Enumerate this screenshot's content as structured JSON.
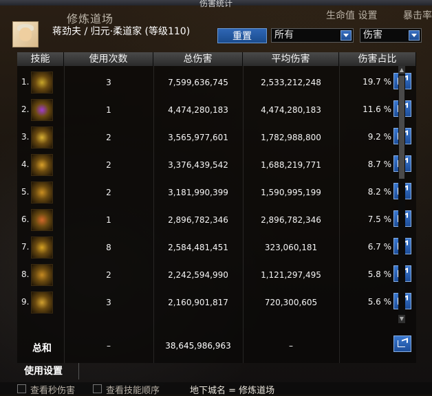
{
  "window": {
    "title": "伤害统计"
  },
  "header": {
    "scene": "修炼道场",
    "character": "蒋劲夫 / 归元·柔道家 (等级110)",
    "reset_label": "重置",
    "filter_selected": "所有",
    "metric_selected": "伤害",
    "side_text_1": "生命值 设置",
    "side_text_2": "暴击率"
  },
  "columns": {
    "skill": "技能",
    "uses": "使用次数",
    "total": "总伤害",
    "avg": "平均伤害",
    "share": "伤害占比"
  },
  "rows": [
    {
      "rank": "1.",
      "uses": "3",
      "total": "7,599,636,745",
      "avg": "2,533,212,248",
      "pct": "19.7 %",
      "icon": "skill-icon-1",
      "color": "#c7a52a"
    },
    {
      "rank": "2.",
      "uses": "1",
      "total": "4,474,280,183",
      "avg": "4,474,280,183",
      "pct": "11.6 %",
      "icon": "skill-icon-2",
      "color": "#a13cd0"
    },
    {
      "rank": "3.",
      "uses": "2",
      "total": "3,565,977,601",
      "avg": "1,782,988,800",
      "pct": "9.2 %",
      "icon": "skill-icon-3",
      "color": "#d8b034"
    },
    {
      "rank": "4.",
      "uses": "2",
      "total": "3,376,439,542",
      "avg": "1,688,219,771",
      "pct": "8.7 %",
      "icon": "skill-icon-4",
      "color": "#d9a02a"
    },
    {
      "rank": "5.",
      "uses": "2",
      "total": "3,181,990,399",
      "avg": "1,590,995,199",
      "pct": "8.2 %",
      "icon": "skill-icon-5",
      "color": "#c98e22"
    },
    {
      "rank": "6.",
      "uses": "1",
      "total": "2,896,782,346",
      "avg": "2,896,782,346",
      "pct": "7.5 %",
      "icon": "skill-icon-6",
      "color": "#d2672a"
    },
    {
      "rank": "7.",
      "uses": "8",
      "total": "2,584,481,451",
      "avg": "323,060,181",
      "pct": "6.7 %",
      "icon": "skill-icon-7",
      "color": "#d6a223"
    },
    {
      "rank": "8.",
      "uses": "2",
      "total": "2,242,594,990",
      "avg": "1,121,297,495",
      "pct": "5.8 %",
      "icon": "skill-icon-8",
      "color": "#c58a22"
    },
    {
      "rank": "9.",
      "uses": "3",
      "total": "2,160,901,817",
      "avg": "720,300,605",
      "pct": "5.6 %",
      "icon": "skill-icon-9",
      "color": "#d0a030"
    }
  ],
  "total": {
    "label": "总和",
    "uses": "–",
    "total": "38,645,986,963",
    "avg": "–"
  },
  "settings_label": "使用设置",
  "bottom": {
    "check1": "查看秒伤害",
    "check2": "查看技能顺序",
    "location": "地下城名 = 修炼道场"
  }
}
